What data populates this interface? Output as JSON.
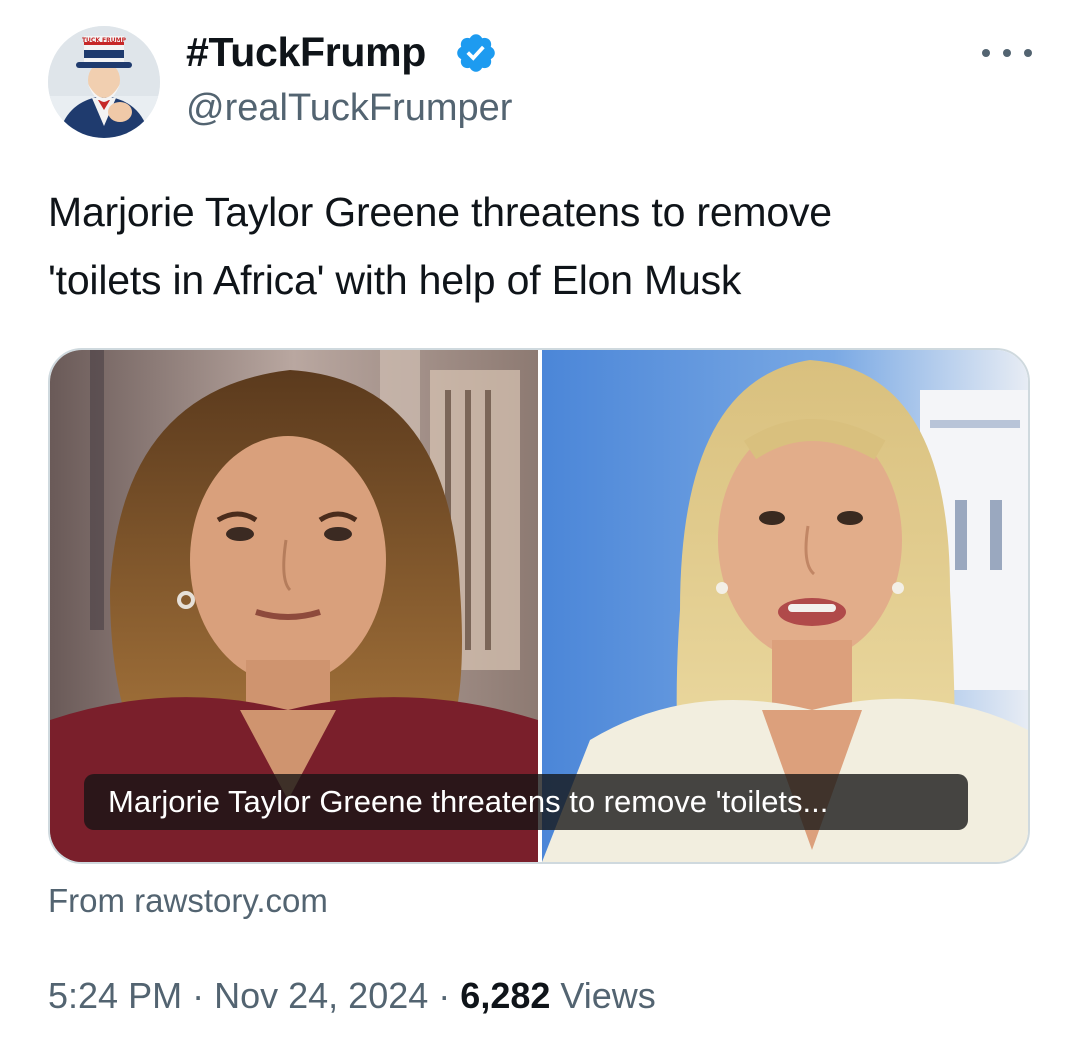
{
  "author": {
    "display_name": "#TuckFrump",
    "handle": "@realTuckFrumper",
    "verified": true,
    "avatar_hat_text": "TUCK FRUMP"
  },
  "tweet": {
    "text_line_1": "Marjorie Taylor Greene threatens to remove",
    "text_line_2": "'toilets in Africa' with help of Elon Musk"
  },
  "link_card": {
    "caption": "Marjorie Taylor Greene threatens to remove 'toilets...",
    "source": "From rawstory.com"
  },
  "meta": {
    "time": "5:24 PM",
    "separator": "·",
    "date": "Nov 24, 2024",
    "views_count": "6,282",
    "views_label": "Views"
  },
  "colors": {
    "verified_blue": "#1d9bf0",
    "secondary_text": "#536471",
    "primary_text": "#0f1419"
  },
  "icons": [
    "verified-badge-icon",
    "more-options-icon"
  ]
}
